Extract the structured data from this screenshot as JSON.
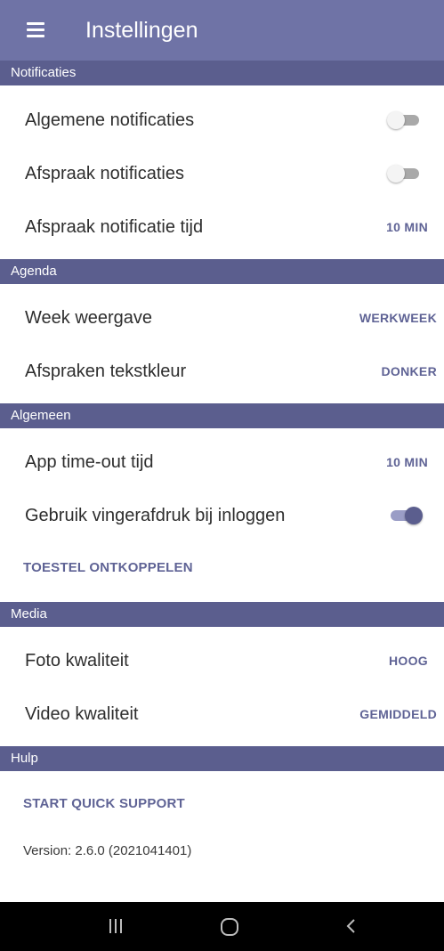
{
  "appbar": {
    "title": "Instellingen",
    "menu_icon": "hamburger-menu-icon",
    "background": "#6f73a6"
  },
  "colors": {
    "section_header": "#5b5e8e",
    "accent_text": "#5f6395",
    "toggle_on": "#5b5e8e",
    "toggle_off_track": "#a9a9a9"
  },
  "sections": {
    "notificaties": {
      "header": "Notificaties",
      "algemene_notificaties": {
        "label": "Algemene notificaties",
        "enabled": false
      },
      "afspraak_notificaties": {
        "label": "Afspraak notificaties",
        "enabled": false
      },
      "afspraak_notificatie_tijd": {
        "label": "Afspraak notificatie tijd",
        "value": "10 MIN"
      }
    },
    "agenda": {
      "header": "Agenda",
      "week_weergave": {
        "label": "Week weergave",
        "value": "WERKWEEK"
      },
      "afspraken_tekstkleur": {
        "label": "Afspraken tekstkleur",
        "value": "DONKER"
      }
    },
    "algemeen": {
      "header": "Algemeen",
      "app_timeout": {
        "label": "App time-out tijd",
        "value": "10 MIN"
      },
      "vingerafdruk": {
        "label": "Gebruik vingerafdruk bij inloggen",
        "enabled": true
      },
      "ontkoppelen": {
        "label": "TOESTEL ONTKOPPELEN"
      }
    },
    "media": {
      "header": "Media",
      "foto_kwaliteit": {
        "label": "Foto kwaliteit",
        "value": "HOOG"
      },
      "video_kwaliteit": {
        "label": "Video kwaliteit",
        "value": "GEMIDDELD"
      }
    },
    "hulp": {
      "header": "Hulp",
      "quick_support": {
        "label": "START QUICK SUPPORT"
      },
      "version": "Version: 2.6.0 (2021041401)"
    }
  },
  "navbar": {
    "recents_icon": "recent-apps-icon",
    "home_icon": "home-icon",
    "back_icon": "back-icon"
  }
}
